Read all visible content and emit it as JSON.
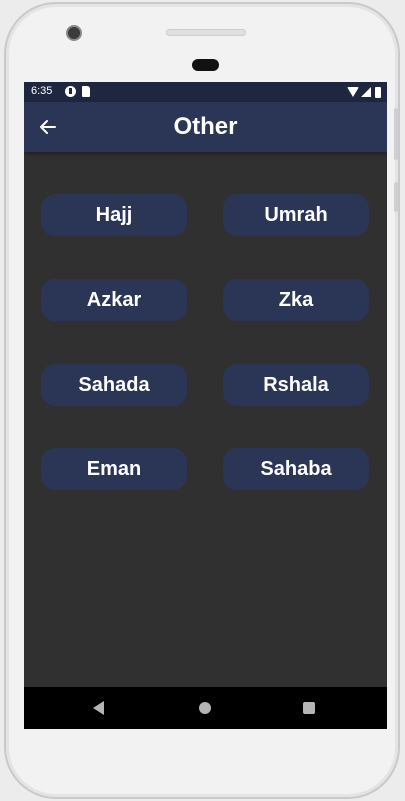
{
  "status_bar": {
    "time": "6:35",
    "icons": [
      "pocket-casts-icon",
      "sd-card-icon",
      "wifi-icon",
      "signal-icon",
      "battery-icon"
    ]
  },
  "app_bar": {
    "title": "Other",
    "back_icon": "arrow-left-icon",
    "background": "#2b3556"
  },
  "buttons": [
    {
      "label": "Hajj"
    },
    {
      "label": "Umrah"
    },
    {
      "label": "Azkar"
    },
    {
      "label": "Zka"
    },
    {
      "label": "Sahada"
    },
    {
      "label": "Rshala"
    },
    {
      "label": "Eman"
    },
    {
      "label": "Sahaba"
    }
  ],
  "nav_bar": {
    "icons": [
      "nav-back-icon",
      "nav-home-icon",
      "nav-recents-icon"
    ]
  },
  "colors": {
    "screen_background": "#303030",
    "button_background": "#2b3556",
    "status_bar": "#1f2640"
  }
}
